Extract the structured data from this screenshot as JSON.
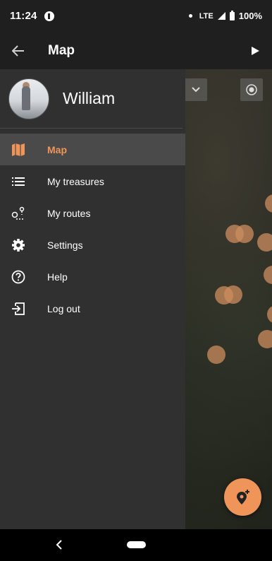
{
  "status_bar": {
    "time": "11:24",
    "network": "LTE",
    "battery": "100%"
  },
  "app_bar": {
    "title": "Map"
  },
  "drawer": {
    "user_name": "William",
    "items": [
      {
        "label": "Map",
        "icon": "map-icon",
        "active": true
      },
      {
        "label": "My treasures",
        "icon": "list-icon",
        "active": false
      },
      {
        "label": "My routes",
        "icon": "route-icon",
        "active": false
      },
      {
        "label": "Settings",
        "icon": "gear-icon",
        "active": false
      },
      {
        "label": "Help",
        "icon": "help-icon",
        "active": false
      },
      {
        "label": "Log out",
        "icon": "logout-icon",
        "active": false
      }
    ]
  },
  "colors": {
    "accent": "#f0955a",
    "drawer_bg": "#303030",
    "bar_bg": "#1f1f1f"
  }
}
